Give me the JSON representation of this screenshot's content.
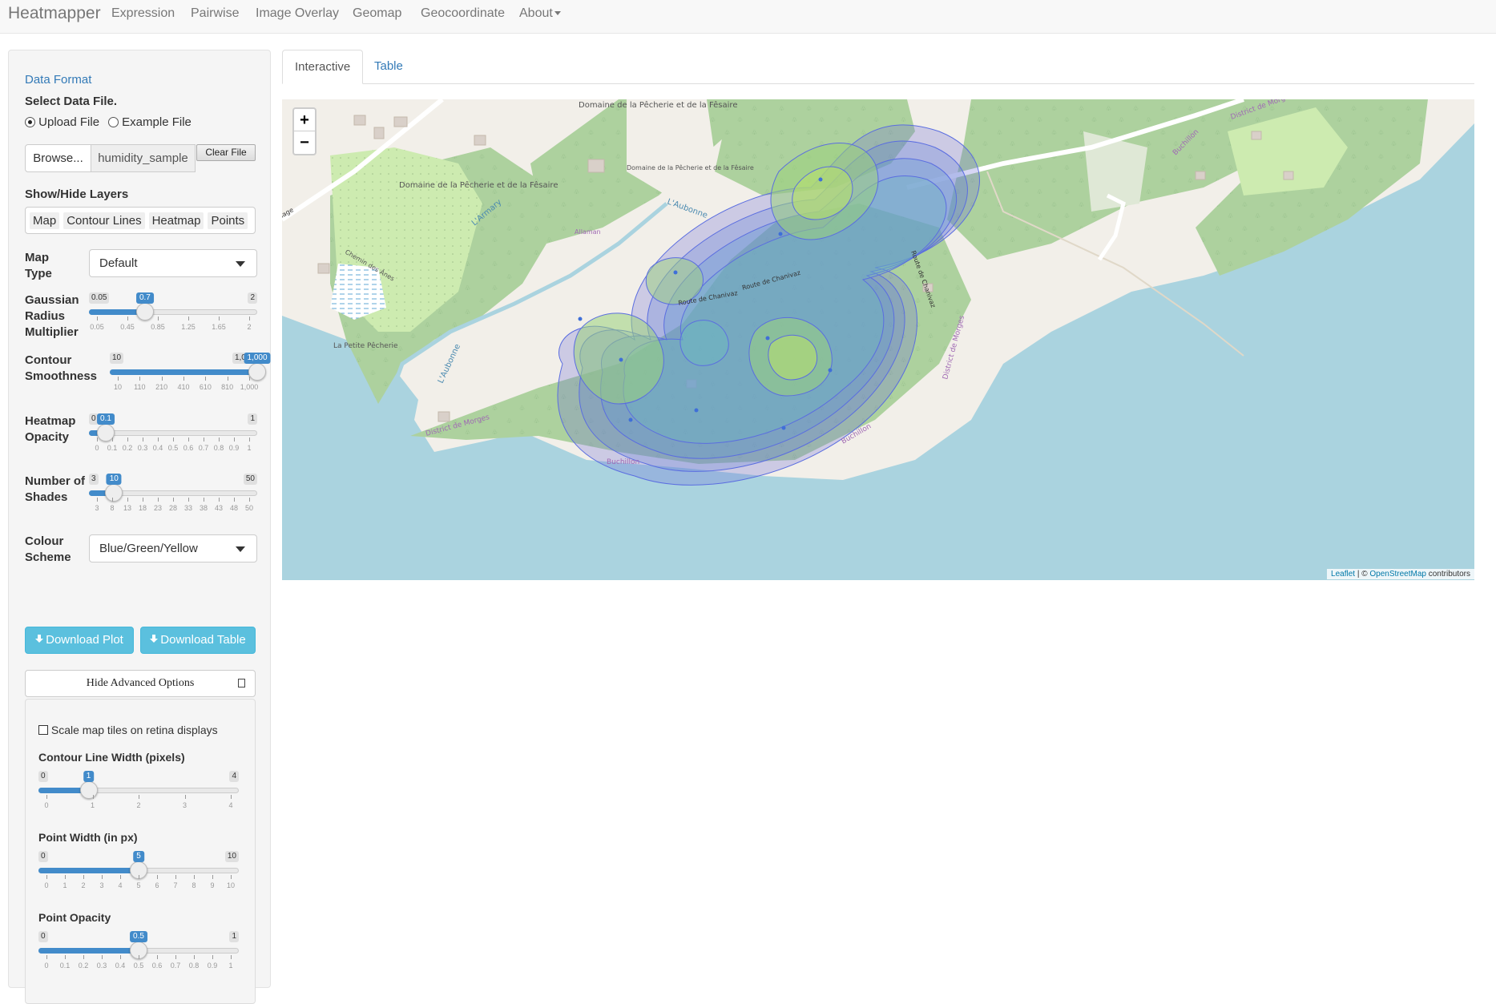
{
  "navbar": {
    "brand": "Heatmapper",
    "items": [
      "Expression",
      "Pairwise",
      "Image Overlay",
      "Geomap",
      "Geocoordinate",
      "About"
    ]
  },
  "sidebar": {
    "data_format": "Data Format",
    "select_file": "Select Data File.",
    "upload_file": "Upload File",
    "example_file": "Example File",
    "browse": "Browse...",
    "file_name": "humidity_sample",
    "clear_file": "Clear File",
    "show_hide_layers": "Show/Hide Layers",
    "layers": [
      "Map",
      "Contour Lines",
      "Heatmap",
      "Points"
    ],
    "map_type_label": "Map Type",
    "map_type_value": "Default",
    "gaussian_label": "Gaussian Radius Multiplier",
    "gaussian": {
      "min": "0.05",
      "max": "2",
      "value": "0.7",
      "ticks": [
        "0.05",
        "0.45",
        "0.85",
        "1.25",
        "1.65",
        "2"
      ]
    },
    "contour_label": "Contour Smoothness",
    "contour": {
      "min": "10",
      "max": "1,000",
      "value": "1,000",
      "ticks": [
        "10",
        "110",
        "210",
        "410",
        "610",
        "810",
        "1,000"
      ]
    },
    "opacity_label": "Heatmap Opacity",
    "opacity": {
      "min": "0",
      "max": "1",
      "value": "0.1",
      "ticks": [
        "0",
        "0.1",
        "0.2",
        "0.3",
        "0.4",
        "0.5",
        "0.6",
        "0.7",
        "0.8",
        "0.9",
        "1"
      ]
    },
    "shades_label": "Number of Shades",
    "shades": {
      "min": "3",
      "max": "50",
      "value": "10",
      "ticks": [
        "3",
        "8",
        "13",
        "18",
        "23",
        "28",
        "33",
        "38",
        "43",
        "48",
        "50"
      ]
    },
    "colour_label": "Colour Scheme",
    "colour_value": "Blue/Green/Yellow",
    "download_plot": "Download Plot",
    "download_table": "Download Table",
    "hide_advanced": "Hide Advanced Options",
    "advanced": {
      "scale_tiles": "Scale map tiles on retina displays",
      "line_width_label": "Contour Line Width (pixels)",
      "line_width": {
        "min": "0",
        "max": "4",
        "value": "1",
        "ticks": [
          "0",
          "1",
          "2",
          "3",
          "4"
        ]
      },
      "point_width_label": "Point Width (in px)",
      "point_width": {
        "min": "0",
        "max": "10",
        "value": "5",
        "ticks": [
          "0",
          "1",
          "2",
          "3",
          "4",
          "5",
          "6",
          "7",
          "8",
          "9",
          "10"
        ]
      },
      "point_opacity_label": "Point Opacity",
      "point_opacity": {
        "min": "0",
        "max": "1",
        "value": "0.5",
        "ticks": [
          "0",
          "0.1",
          "0.2",
          "0.3",
          "0.4",
          "0.5",
          "0.6",
          "0.7",
          "0.8",
          "0.9",
          "1"
        ]
      }
    }
  },
  "tabs": [
    "Interactive",
    "Table"
  ],
  "map": {
    "zoom_in": "+",
    "zoom_out": "−",
    "labels": {
      "domaine1": "Domaine de la Pêcherie et de la Fêsaire",
      "domaine2": "Domaine de la Pêcherie et de la Fêsaire",
      "domaine3": "Domaine de la Pêcherie et de la Fêsaire",
      "armary": "L'Armary",
      "aubonne1": "L'Aubonne",
      "aubonne2": "L'Aubonne",
      "allaman": "Allaman",
      "chemin_anes": "Chemin des Ânes",
      "petite_pecherie": "La Petite Pêcherie",
      "route_chanivaz1": "Route de Chanivaz",
      "route_chanivaz2": "Route de Chanivaz",
      "route_chanivaz3": "Route de Chanivaz",
      "district_morges1": "District de Morges",
      "district_morges2": "District de Morges",
      "district_morges3": "District de Morges",
      "buchillon1": "Buchillon",
      "buchillon2": "Buchillon",
      "buchillon3": "Buchillon",
      "lage": "lage"
    },
    "attribution_leaflet": "Leaflet",
    "attribution_sep": " | © ",
    "attribution_osm": "OpenStreetMap",
    "attribution_rest": " contributors",
    "colors": {
      "water": "#aad3df",
      "forest": "#add19e",
      "land": "#f2efe9"
    }
  }
}
